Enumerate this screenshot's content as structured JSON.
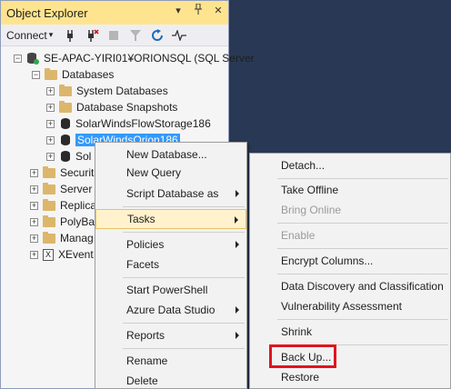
{
  "object_explorer": {
    "title": "Object Explorer",
    "title_buttons": [
      "▾",
      "╨",
      "✕"
    ],
    "toolbar": {
      "connect_label": "Connect",
      "connect_arrow": "▾"
    },
    "tree": {
      "server": "SE-APAC-YIRI01¥ORIONSQL (SQL Server",
      "databases": "Databases",
      "system_databases": "System Databases",
      "snapshots": "Database Snapshots",
      "flowstorage": "SolarWindsFlowStorage186",
      "orion": "SolarWindsOrion186",
      "sol_partial": "Sol",
      "security": "Securit",
      "server_objects": "Server",
      "replication": "Replica",
      "polybase": "PolyBa",
      "management": "Manag",
      "xevent": "XEvent"
    }
  },
  "context_menu": {
    "items": {
      "new_database": "New Database...",
      "new_query": "New Query",
      "script_database": "Script Database as",
      "tasks": "Tasks",
      "policies": "Policies",
      "facets": "Facets",
      "start_powershell": "Start PowerShell",
      "azure_data_studio": "Azure Data Studio",
      "reports": "Reports",
      "rename": "Rename",
      "delete": "Delete"
    }
  },
  "tasks_submenu": {
    "items": {
      "detach": "Detach...",
      "take_offline": "Take Offline",
      "bring_online": "Bring Online",
      "enable": "Enable",
      "encrypt_columns": "Encrypt Columns...",
      "data_discovery": "Data Discovery and Classification",
      "vulnerability": "Vulnerability Assessment",
      "shrink": "Shrink",
      "back_up": "Back Up...",
      "restore": "Restore"
    }
  },
  "colors": {
    "background": "#293955",
    "title_bar": "#ffe48f",
    "selection": "#3399ff",
    "highlight_box": "#e0141e"
  }
}
